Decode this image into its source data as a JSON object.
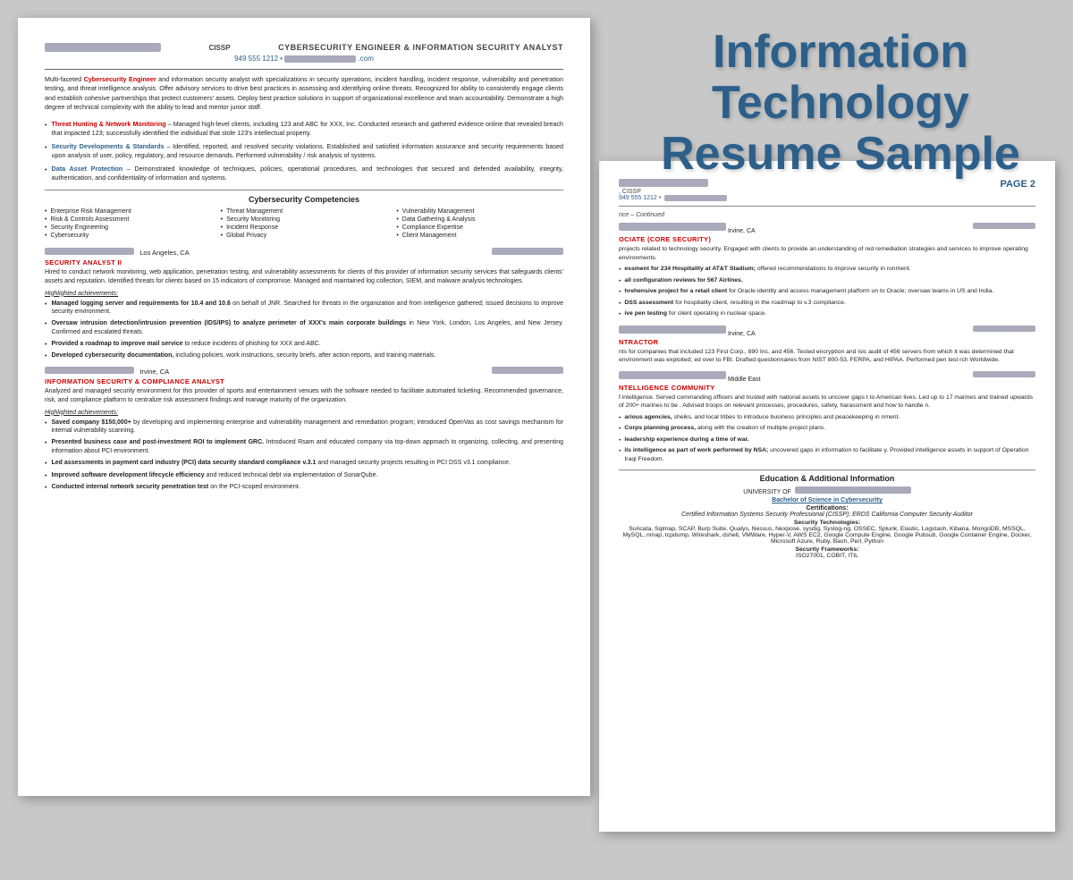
{
  "title": {
    "line1": "Information Technology",
    "line2": "Resume Sample"
  },
  "page1": {
    "cissp_label": "CISSP",
    "title_text": "CYBERSECURITY ENGINEER & INFORMATION SECURITY ANALYST",
    "phone": "949 555 1212 •",
    "email_suffix": ".com",
    "summary": "Multi-faceted Cybersecurity Engineer and information security analyst with specializations in security operations, incident handling, incident response, vulnerability and penetration testing, and threat intelligence analysis. Offer advisory services to drive best practices in assessing and identifying online threats. Recognized for ability to consistently engage clients and establish cohesive partnerships that protect customers' assets. Deploy best practice solutions in support of organizational excellence and team accountability. Demonstrate a high degree of technical complexity with the ability to lead and mentor junior staff.",
    "bullets": [
      {
        "label": "Threat Hunting & Network Monitoring",
        "color": "red",
        "text": " – Managed high-level clients, including 123 and ABC for XXX, Inc. Conducted research and gathered evidence online that revealed breach that impacted 123; successfully identified the individual that stole 123's intellectual property."
      },
      {
        "label": "Security Developments & Standards",
        "color": "blue",
        "text": " – Identified, reported, and resolved security violations. Established and satisfied information assurance and security requirements based upon analysis of user, policy, regulatory, and resource demands. Performed vulnerability / risk analysis of systems."
      },
      {
        "label": "Data Asset Protection",
        "color": "blue",
        "text": " – Demonstrated knowledge of techniques, policies, operational procedures, and technologies that secured and defended availability, integrity, authentication, and confidentiality of information and systems."
      }
    ],
    "competencies_heading": "Cybersecurity Competencies",
    "competencies": [
      "Enterprise Risk Management",
      "Risk & Controls Assessment",
      "Security Engineering",
      "Cybersecurity",
      "Threat Management",
      "Security Monitoring",
      "Incident Response",
      "Global Privacy",
      "Vulnerability Management",
      "Data Gathering & Analysis",
      "Compliance Expertise",
      "Client Management"
    ],
    "jobs": [
      {
        "location": "Los Angeles, CA",
        "title": "SECURITY ANALYST II",
        "desc": "Hired to conduct network monitoring, web application, penetration testing, and vulnerability assessments for clients of this provider of information security services that safeguards clients' assets and reputation. Identified threats for clients based on 15 indicators of compromise. Managed and maintained log collection, SIEM, and malware analysis technologies.",
        "achievements": [
          {
            "bold_part": "Managed logging server and requirements for 10.4 and 10.6",
            "rest": " on behalf of JNR. Searched for threats in the organization and from intelligence gathered; issued decisions to improve security environment."
          },
          {
            "bold_part": "Oversaw intrusion detection/intrusion prevention (IDS/IPS) to analyze perimeter of XXX's main corporate buildings",
            "rest": " in New York, London, Los Angeles, and New Jersey. Confirmed and escalated threats."
          },
          {
            "bold_part": "Provided a roadmap to improve mail service",
            "rest": " to reduce incidents of phishing for XXX and ABC."
          },
          {
            "bold_part": "Developed cybersecurity documentation,",
            "rest": " including policies, work instructions, security briefs, after action reports, and training materials."
          }
        ]
      },
      {
        "location": "Irvine, CA",
        "title": "INFORMATION SECURITY & COMPLIANCE ANALYST",
        "desc": "Analyzed and managed security environment for this provider of sports and entertainment venues with the software needed to facilitate automated ticketing. Recommended governance, risk, and compliance platform to centralize risk assessment findings and manage maturity of the organization.",
        "achievements": [
          {
            "bold_part": "Saved company $150,000+",
            "rest": " by developing and implementing enterprise and vulnerability management and remediation program; introduced OpenVas as cost savings mechanism for internal vulnerability scanning."
          },
          {
            "bold_part": "Presented business case and post-investment ROI to implement GRC.",
            "rest": " Introduced Rsam and educated company via top-down approach to organizing, collecting, and presenting information about PCI environment."
          },
          {
            "bold_part": "Led assessments in payment card industry (PCI) data security standard compliance v.3.1",
            "rest": " and managed security projects resulting in PCI DSS v3.1 compliance."
          },
          {
            "bold_part": "Improved software development lifecycle efficiency",
            "rest": " and reduced technical debt via implementation of SonarQube."
          },
          {
            "bold_part": "Conducted internal network security penetration test",
            "rest": " on the PCI-scoped environment."
          }
        ]
      }
    ]
  },
  "page2": {
    "cissp_label": ", CISSP",
    "phone": "949 555 1212 •",
    "page_label": "PAGE 2",
    "continued_label": "nce – Continued",
    "jobs": [
      {
        "location": "Irvine, CA",
        "title_prefix": "OCIATE (CORE SECURITY)",
        "desc": "projects related to technology security. Engaged with clients to provide an understanding of red remediation strategies and services to improve operating environments.",
        "achievements": [
          {
            "bold_part": "essment for 234 Hospitality at AT&T Stadium;",
            "rest": " offered recommendations to improve security in ronment."
          },
          {
            "bold_part": "all configuration reviews for 567 Airlines.",
            "rest": ""
          },
          {
            "bold_part": "hrehensive project for a retail client",
            "rest": " for Oracle identity and access management platform un to Oracle; oversaw teams in US and India."
          },
          {
            "bold_part": "DSS assessment",
            "rest": " for hospitality client, resulting in the roadmap to v.3 compliance."
          },
          {
            "bold_part": "ive pen testing",
            "rest": " for client operating in nuclear space."
          }
        ]
      },
      {
        "location": "Irvine, CA",
        "title_prefix": "NTRACTOR",
        "desc": "nts for companies that included 123 First Corp., 890 Inc, and 456. Tested encryption and isic audit of 456 servers from which it was determined that environment was exploited; ed over to FBI. Drafted questionnaires from NIST 800-53, FERPA, and HIPAA. Performed pen test rch Worldwide."
      },
      {
        "location": "Middle East",
        "title_prefix": "NTELLIGENCE COMMUNITY",
        "desc": "f intelligence. Served commanding officers and trusted with national assets to uncover gaps t to American lives. Led up to 17 marines and trained upwards of 200+ marines to be . Advised troops on relevant processes, procedures, safety, harassment and how to handle n.",
        "achievements": [
          {
            "bold_part": "arious agencies,",
            "rest": " sheiks, and local tribes to introduce business principles and peacekeeping in nment."
          },
          {
            "bold_part": "Corps planning process,",
            "rest": " along with the creation of multiple project plans."
          },
          {
            "bold_part": "leadership experience during a time of war.",
            "rest": ""
          },
          {
            "bold_part": "ils intelligence as part of work performed by NSA;",
            "rest": " uncovered gaps in information to facilitate y. Provided intelligence assets in support of Operation Iraqi Freedom."
          }
        ]
      }
    ],
    "education_heading": "Education & Additional Information",
    "university_text": "UNIVERSITY OF",
    "degree": "Bachelor of Science in Cybersecurity",
    "certifications_label": "Certifications:",
    "certifications_text": "Certified Information Systems Security Professional (CISSP); ERDS California Computer Security Auditor",
    "security_tech_label": "Security Technologies:",
    "security_tech_text": "Suricata, Sqlmap, SCAP, Burp Suite, Qualys, Nessus, Nexpose, sysdig, Syslog-ng, OSSEC, Splunk, Elastic, Logstash, Kibana, MongoDB, MSSQL, MySQL, nmap, tcpdump, Wireshark, dshell, VMWare, Hyper-V, AWS EC2, Google Compute Engine, Google Pubsub, Google Container Engine, Docker, Microsoft Azure, Ruby, Bash, Perl, Python",
    "security_frameworks_label": "Security Frameworks:",
    "security_frameworks_text": "ISO27001, COBIT, ITIL"
  }
}
